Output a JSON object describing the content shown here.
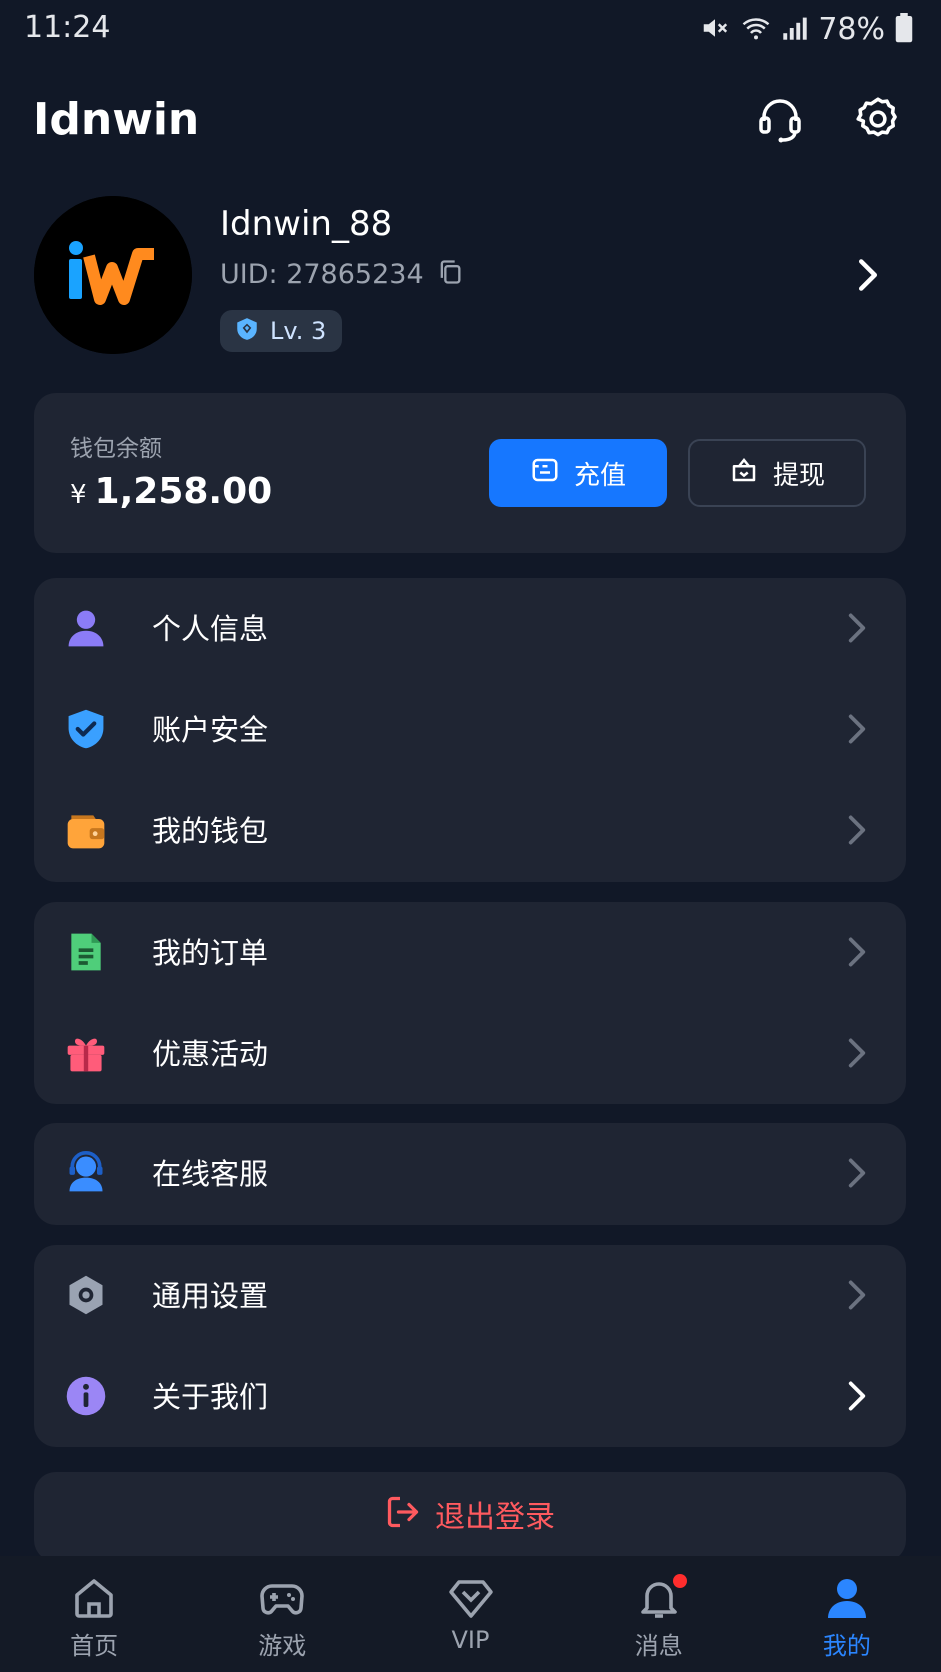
{
  "status_bar": {
    "time": "11:24",
    "battery": "78%"
  },
  "header": {
    "title": "Idnwin"
  },
  "profile": {
    "avatar_text": "iW",
    "username": "Idnwin_88",
    "uid": "UID: 27865234",
    "level": "Lv. 3"
  },
  "wallet": {
    "label": "钱包余额",
    "currency": "¥",
    "balance": "1,258.00",
    "recharge_label": "充值",
    "withdraw_label": "提现"
  },
  "menu": {
    "group1": [
      {
        "label": "个人信息",
        "icon": "user-icon"
      },
      {
        "label": "账户安全",
        "icon": "shield-check-icon"
      },
      {
        "label": "我的钱包",
        "icon": "wallet-icon"
      }
    ],
    "group2": [
      {
        "label": "我的订单",
        "icon": "document-icon"
      },
      {
        "label": "优惠活动",
        "icon": "gift-icon"
      }
    ],
    "group3": [
      {
        "label": "在线客服",
        "icon": "headset-user-icon"
      }
    ],
    "group4": [
      {
        "label": "通用设置",
        "icon": "settings-icon"
      },
      {
        "label": "关于我们",
        "icon": "info-icon"
      }
    ]
  },
  "logout": {
    "label": "退出登录"
  },
  "nav": [
    {
      "label": "首页",
      "icon": "home-icon"
    },
    {
      "label": "游戏",
      "icon": "gamepad-icon"
    },
    {
      "label": "VIP",
      "icon": "diamond-icon"
    },
    {
      "label": "消息",
      "icon": "bell-icon"
    },
    {
      "label": "我的",
      "icon": "profile-icon"
    }
  ],
  "colors": {
    "background": "#111827",
    "card": "#1f2533",
    "accent": "#1677ff",
    "logout": "#ff5a5f"
  }
}
